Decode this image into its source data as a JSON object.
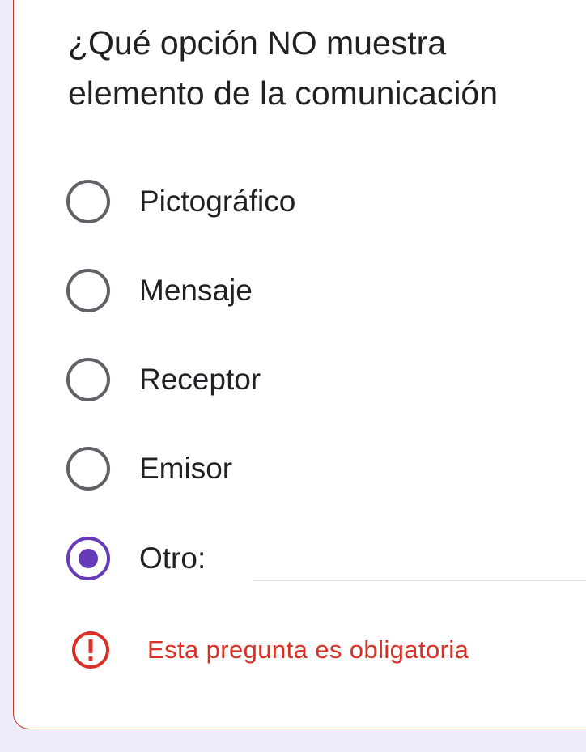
{
  "question": {
    "title": "¿Qué opción NO muestra elemento de la comunicación"
  },
  "options": [
    {
      "label": "Pictográfico",
      "selected": false
    },
    {
      "label": "Mensaje",
      "selected": false
    },
    {
      "label": "Receptor",
      "selected": false
    },
    {
      "label": "Emisor",
      "selected": false
    },
    {
      "label": "Otro:",
      "selected": true,
      "input_value": ""
    }
  ],
  "error": {
    "message": "Esta pregunta es obligatoria",
    "icon": "alert-icon"
  },
  "colors": {
    "background": "#f0ebf8",
    "card": "#ffffff",
    "accent": "#673ab7",
    "error": "#d93025",
    "radio_unselected": "#5f6368",
    "text": "#202124"
  }
}
